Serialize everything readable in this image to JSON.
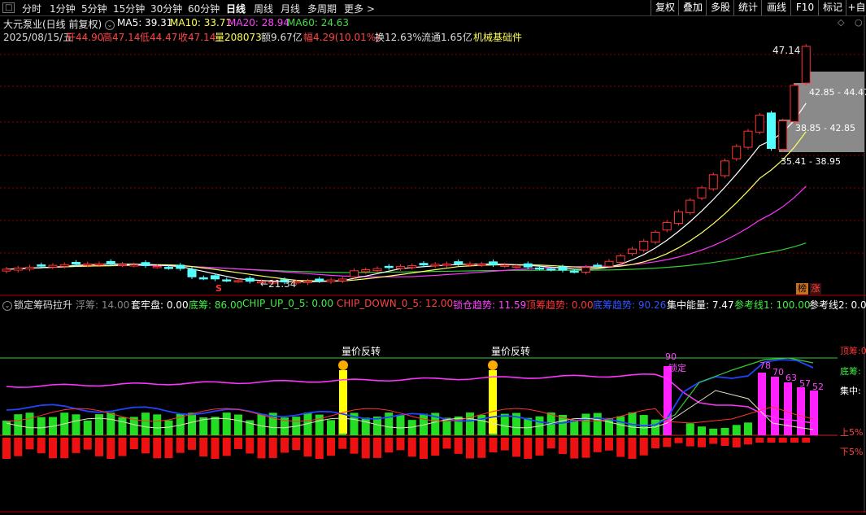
{
  "toolbar": {
    "periods": [
      "分时",
      "1分钟",
      "5分钟",
      "15分钟",
      "30分钟",
      "60分钟",
      "日线",
      "周线",
      "月线",
      "多周期",
      "更多 >"
    ],
    "active_period": "日线",
    "right_buttons": [
      "复权",
      "叠加",
      "多股",
      "统计",
      "画线",
      "F10",
      "标记",
      "+自"
    ]
  },
  "header": {
    "stock_title": "大元泵业(日线 前复权)",
    "ma5": "MA5: 39.31",
    "ma10": "MA10: 33.71",
    "ma20": "MA20: 28.94",
    "ma60": "MA60: 24.63",
    "date": "2025/08/15/五",
    "open": "开44.90",
    "high": "高47.14",
    "low": "低44.47",
    "close": "收47.14",
    "volume": "量208073",
    "amount": "额9.67亿",
    "change": "幅4.29(10.01%)",
    "turnover": "换12.63%",
    "float_value": "流通1.65亿",
    "sector": "机械基础件"
  },
  "main_chart": {
    "max_price_label": "47.14",
    "min_price_label": "←21.34",
    "chip_zones": [
      "42.85 - 44.47",
      "38.85 - 42.85",
      "35.41 - 38.95"
    ],
    "flag_s": "S",
    "badge_bang": "榜",
    "badge_zhang": "涨"
  },
  "indicator": {
    "name": "锁定筹码拉升",
    "fuchou": "浮筹: 14.00",
    "taolao": "套牢盘: 0.00",
    "dichou": "底筹: 86.00",
    "chip_up": "CHIP_UP_0_5: 0.00",
    "chip_down": "CHIP_DOWN_0_5: 12.00",
    "lock_trend": "锁仓趋势: 11.59",
    "top_trend": "顶筹趋势: 0.00",
    "bottom_trend": "底筹趋势: 90.26",
    "concentration": "集中能量: 7.47",
    "ref1": "参考线1: 100.00",
    "ref2": "参考线2: 0.0",
    "signal_1": "量价反转",
    "signal_2": "量价反转",
    "lock_value": "90",
    "lock_label": "锁定",
    "lock_values_right": [
      "78",
      "70",
      "63",
      "57",
      "52"
    ],
    "right_labels": [
      "顶筹:0",
      "底筹:",
      "集中:",
      "上5%",
      "下5%"
    ]
  },
  "chart_data": [
    {
      "type": "candlestick",
      "title": "大元泵业(日线 前复权)",
      "last_bars": [
        {
          "open": 39.2,
          "close": 38.95
        },
        {
          "open": 38.95,
          "close": 42.85
        },
        {
          "open": 44.9,
          "close": 47.14
        }
      ],
      "last_close": 47.14,
      "period_low": 21.34,
      "ma_lines": [
        "MA5",
        "MA10",
        "MA20",
        "MA60"
      ],
      "ma_colors": {
        "MA5": "#ffffff",
        "MA10": "#ffff66",
        "MA20": "#ff33ff",
        "MA60": "#33cc33"
      }
    },
    {
      "type": "bar",
      "title": "锁定筹码拉升",
      "note": "green/red histogram with lock signal columns",
      "lock_values": [
        90,
        78,
        70,
        63,
        57,
        52
      ]
    }
  ],
  "colors": {
    "up": "#ff3232",
    "down": "#54ffff",
    "grid": "#8b0000",
    "panel_line": "#b30000"
  }
}
